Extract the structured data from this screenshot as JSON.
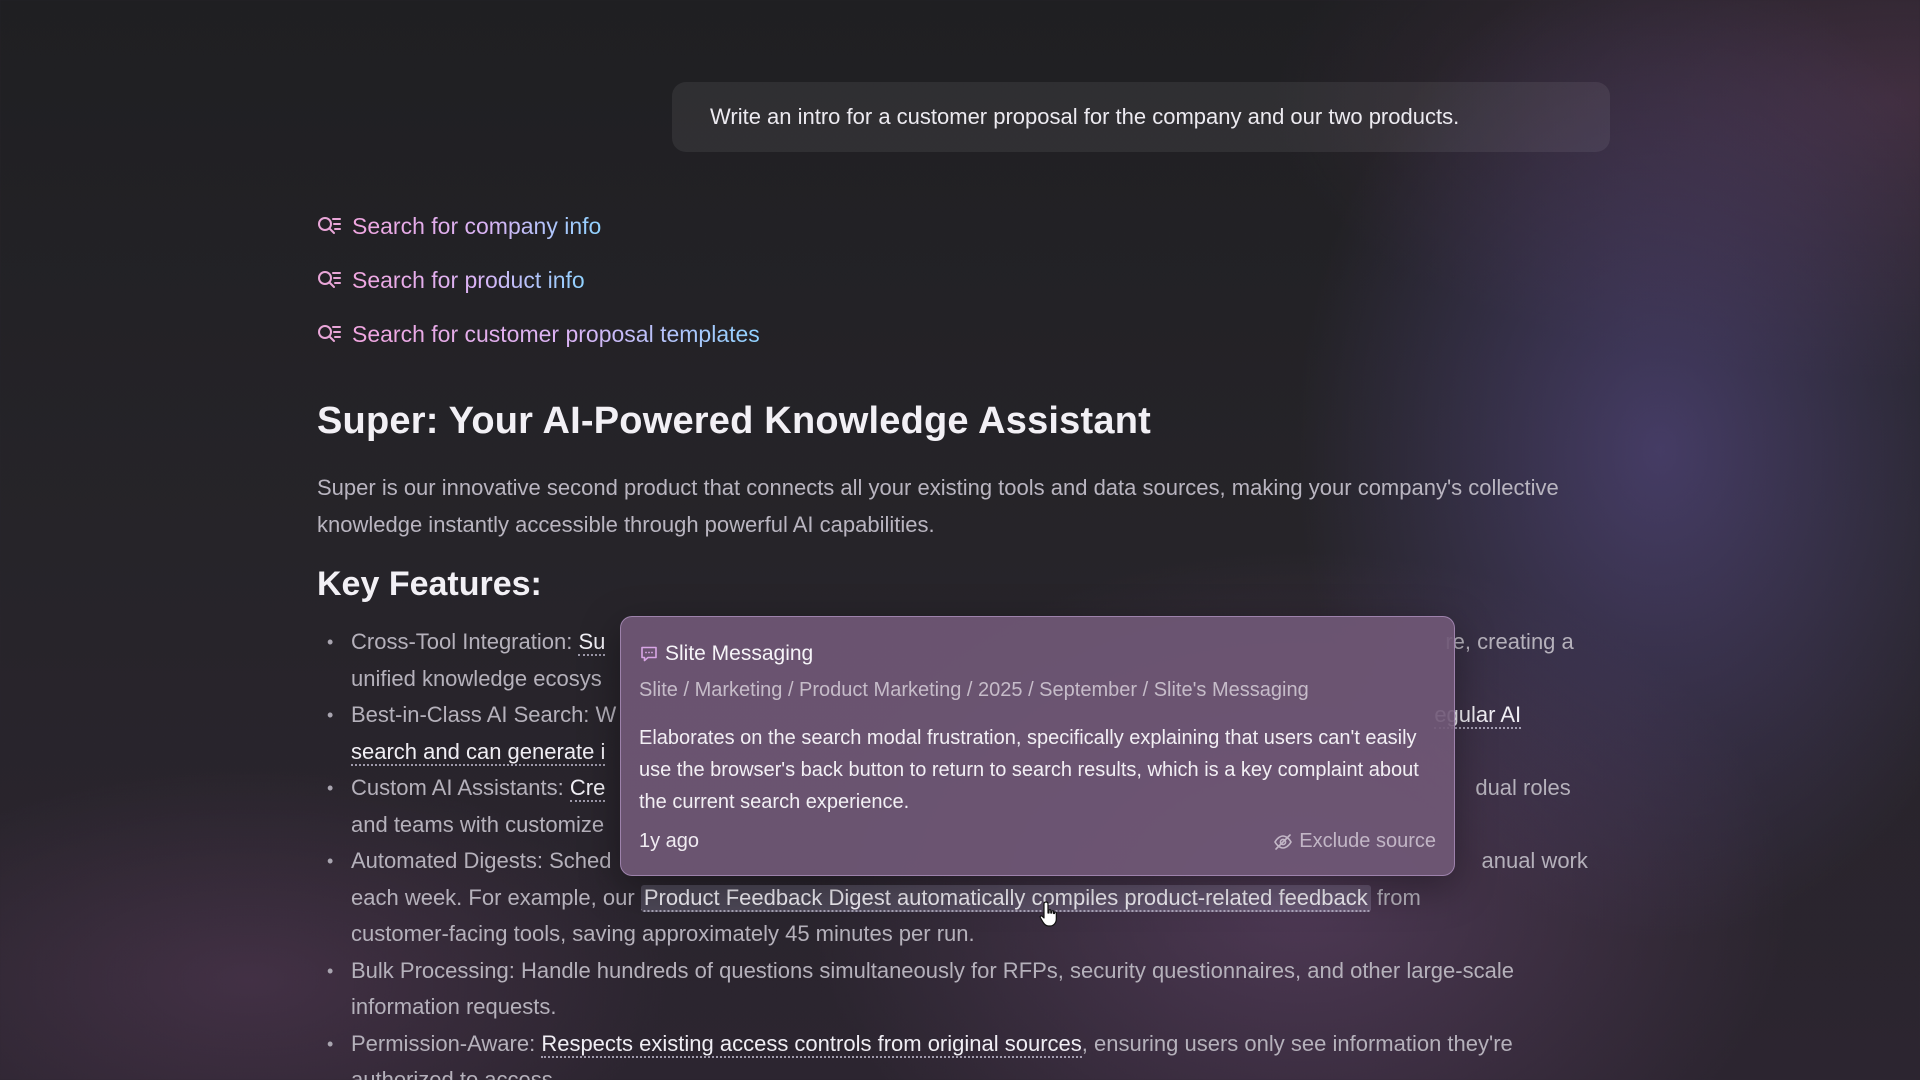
{
  "prompt": "Write an intro for a customer proposal for the company and our two products.",
  "steps": [
    {
      "icon": "search-list-icon",
      "label": "Search for company info"
    },
    {
      "icon": "search-list-icon",
      "label": "Search for product info"
    },
    {
      "icon": "search-list-icon",
      "label": "Search for customer proposal templates"
    }
  ],
  "doc": {
    "title": "Super: Your AI-Powered Knowledge Assistant",
    "intro": "Super is our innovative second product that connects all your existing tools and data sources, making your company's collective knowledge instantly accessible through powerful AI capabilities.",
    "features_heading": "Key Features:",
    "features": [
      {
        "a": "Cross-Tool Integration: ",
        "b": "Su",
        "c": "",
        "d": "re, creating a",
        "e": "unified knowledge ecosys"
      },
      {
        "a": "Best-in-Class AI Search: W",
        "b": "egular AI",
        "c": "search and can generate i"
      },
      {
        "a": "Custom AI Assistants: ",
        "b": "Cre",
        "c": "dual roles",
        "d": "and teams with customize"
      },
      {
        "a": "Automated Digests: Sched",
        "b": "anual work",
        "c": "each week. For example, our ",
        "d": "Product Feedback Digest automatically compiles product-related feedback",
        "e": " from",
        "f": "customer-facing tools, saving approximately 45 minutes per run."
      },
      {
        "a": "Bulk Processing: Handle hundreds of questions simultaneously for RFPs, security questionnaires, and other large-scale information requests."
      },
      {
        "a": "Permission-Aware: ",
        "b": "Respects existing access controls from original sources",
        "c": ", ensuring users only see information they're authorized to access."
      }
    ]
  },
  "popover": {
    "icon": "message-icon",
    "title": "Slite Messaging",
    "path": "Slite / Marketing / Product Marketing / 2025 / September / Slite's Messaging",
    "description": "Elaborates on the search modal frustration, specifically explaining that users can't easily use the browser's back button to return to search results, which is a key complaint about the current search experience.",
    "time": "1y ago",
    "exclude_icon": "eye-off-icon",
    "exclude_label": "Exclude source"
  }
}
